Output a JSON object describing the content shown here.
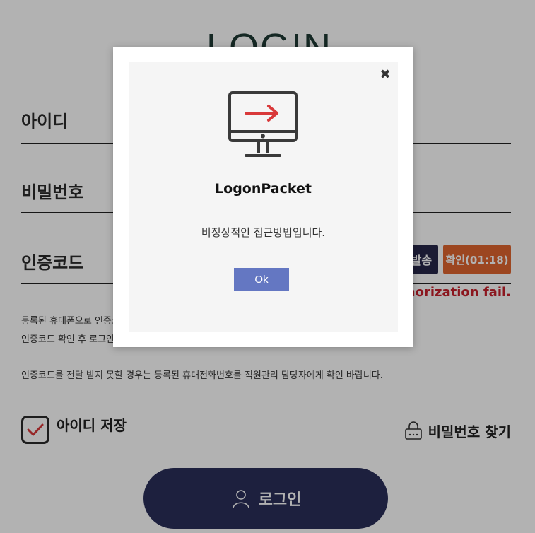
{
  "login": {
    "title": "LOGIN",
    "id_label": "아이디",
    "password_label": "비밀번호",
    "auth_label": "인증코드",
    "send_button": "재발송",
    "confirm_button": "확인(01:18)",
    "auth_fail": "Authorization fail.",
    "info_line1": "등록된 휴대폰으로 인증코드가 발송되었습니다.",
    "info_line2": "인증코드 확인 후 로그인 하시기 바랍니다.",
    "info_line3": "인증코드를 전달 받지 못할 경우는 등록된 휴대전화번호를 직원관리 담당자에게 확인 바랍니다.",
    "save_id_label": "아이디 저장",
    "find_password_label": "비밀번호 찾기",
    "login_button": "로그인"
  },
  "modal": {
    "close_icon": "close-icon",
    "icon": "monitor-arrow-icon",
    "title": "LogonPacket",
    "message": "비정상적인 접근방법입니다.",
    "ok_button": "Ok"
  },
  "colors": {
    "nav_dark": "#27274a",
    "confirm_orange": "#e0652e",
    "error_red": "#c8202b",
    "login_button_bg": "#2a2f5a",
    "ok_button_bg": "#6477c2",
    "arrow_red": "#d9393a"
  }
}
